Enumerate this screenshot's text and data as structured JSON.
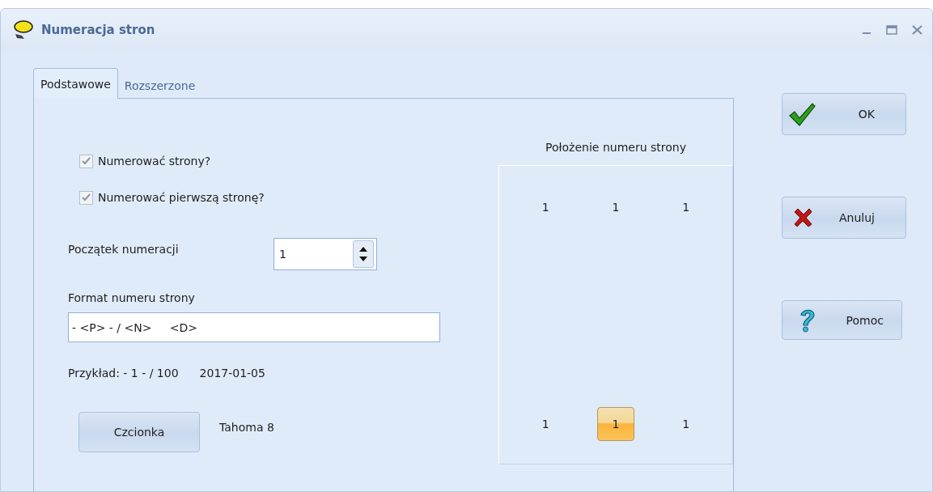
{
  "window": {
    "title": "Numeracja stron"
  },
  "tabs": [
    {
      "label": "Podstawowe",
      "selected": true
    },
    {
      "label": "Rozszerzone",
      "selected": false
    }
  ],
  "checkboxes": [
    {
      "label": "Numerować strony?",
      "checked": true
    },
    {
      "label": "Numerować pierwszą stronę?",
      "checked": true
    }
  ],
  "start": {
    "label": "Początek numeracji",
    "value": "1"
  },
  "format": {
    "label": "Format numeru strony",
    "value": "- <P> - / <N>     <D>"
  },
  "example": {
    "label": "Przykład: - 1 - / 100",
    "date": "2017-01-05"
  },
  "font": {
    "button": "Czcionka",
    "name": "Tahoma 8"
  },
  "position": {
    "title": "Położenie numeru strony",
    "cells": [
      {
        "label": "1",
        "selected": false
      },
      {
        "label": "1",
        "selected": false
      },
      {
        "label": "1",
        "selected": false
      },
      {
        "label": "1",
        "selected": false
      },
      {
        "label": "1",
        "selected": true
      },
      {
        "label": "1",
        "selected": false
      }
    ]
  },
  "buttons": [
    {
      "label": "OK",
      "kind": "ok"
    },
    {
      "label": "Anuluj",
      "kind": "cancel"
    },
    {
      "label": "Pomoc",
      "kind": "help"
    }
  ]
}
